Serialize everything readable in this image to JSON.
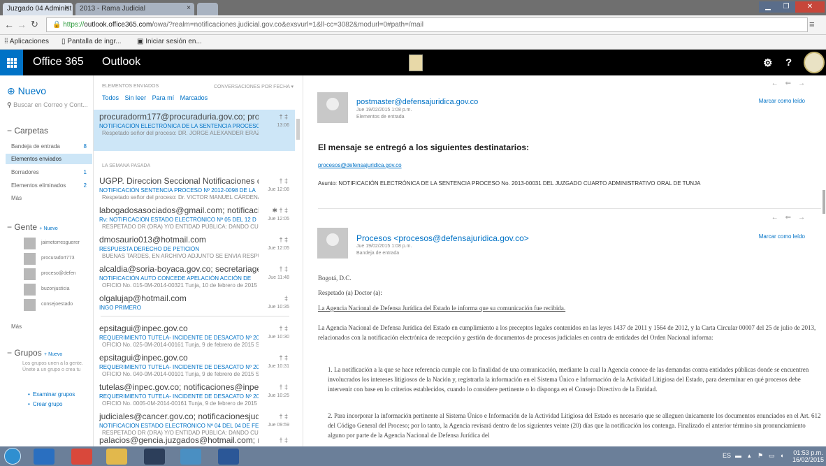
{
  "browser": {
    "tabs": [
      {
        "label": "Juzgado 04 Administ"
      },
      {
        "label": "2013 - Rama Judicial"
      }
    ],
    "url_scheme": "https://",
    "url_host": "outlook.office365.com",
    "url_rest": "/owa/?realm=notificaciones.judicial.gov.co&exsvurl=1&ll-cc=3082&modurl=0#path=/mail",
    "bookmarks": [
      "Aplicaciones",
      "Pantalla de ingr...",
      "Iniciar sesión en..."
    ]
  },
  "header": {
    "brand": "Office 365",
    "app": "Outlook",
    "settings_icon": "gear-icon",
    "help_label": "?"
  },
  "leftnav": {
    "new_label": "Nuevo",
    "search_placeholder": "Buscar en Correo y Cont...",
    "folders_label": "Carpetas",
    "folders": [
      {
        "label": "Bandeja de entrada",
        "count": "8"
      },
      {
        "label": "Elementos enviados",
        "count": ""
      },
      {
        "label": "Borradores",
        "count": "1"
      },
      {
        "label": "Elementos eliminados",
        "count": "2"
      },
      {
        "label": "Más",
        "count": ""
      }
    ],
    "people_label": "Gente",
    "people_new": "+ Nuevo",
    "contacts": [
      "jaimetorresguerer",
      "procuradort773",
      "proceso@defen",
      "buzonjusticia",
      "consejoestado"
    ],
    "people_more": "Más",
    "groups_label": "Grupos",
    "groups_new": "+ Nuevo",
    "groups_desc": "Los grupos unen a la gente. Únete a un grupo o crea tu",
    "groups_links": [
      "Examinar grupos",
      "Crear grupo"
    ]
  },
  "msglist": {
    "top_left": "ELEMENTOS ENVIADOS",
    "top_right": "CONVERSACIONES POR FECHA ▾",
    "filters": [
      "Todos",
      "Sin leer",
      "Para mí",
      "Marcados"
    ],
    "section_label": "LA SEMANA PASADA",
    "messages": [
      {
        "from": "procuradorm177@procuraduria.gov.co; proc",
        "subj": "NOTIFICACIÓN ELECTRÓNICA DE LA SENTENCIA PROCESO",
        "prev": "Respetado señor del proceso: DR. JORGE ALEXANDER ERAZO ERAZO...",
        "time": "13:06",
        "flags": "† ‡"
      },
      {
        "from": "UGPP. Direccion Seccional Notificaciones de",
        "subj": "NOTIFICACIÓN SENTENCIA PROCESO Nº 2012-0098 DE LA",
        "prev": "Respetado señor del proceso: Dr. VICTOR MANUEL CÁRDENAS...",
        "time": "Jue 12:08",
        "flags": "† ‡"
      },
      {
        "from": "labogadosasociados@gmail.com; notificaci",
        "subj": "Rv: NOTIFICACIÓN ESTADO ELECTRÓNICO Nº 05 DEL 12 D",
        "prev": "RESPETADO DR (DRA) Y/O ENTIDAD PÚBLICA: DANDO CUMPLI...",
        "time": "Jue 12:05",
        "flags": "✱ † ‡"
      },
      {
        "from": "dmosaurio013@hotmail.com",
        "subj": "RESPUESTA DERECHO DE PETICIÓN",
        "prev": "BUENAS TARDES,  EN ARCHIVO ADJUNTO SE ENVIA RESPUESTA...",
        "time": "Jue 12:05",
        "flags": "† ‡"
      },
      {
        "from": "alcaldia@soria-boyaca.gov.co; secretariagen",
        "subj": "NOTIFICACIÓN AUTO CONCEDE APELACIÓN ACCIÓN DE",
        "prev": "OFICIO No. 015-0M-2014-00321  Tunja, 10 de febrero de 2015  S...",
        "time": "Jue 11:48",
        "flags": "† ‡"
      },
      {
        "from": "olgalujap@hotmail.com",
        "subj": "INGO PRIMERO",
        "prev": "",
        "time": "Jue 10:35",
        "flags": "‡"
      },
      {
        "from": "epsitagui@inpec.gov.co",
        "subj": "REQUERIMIENTO TUTELA- INCIDENTE DE DESACATO Nº 20",
        "prev": "OFICIO No. 025-0M-2014-00161  Tunja, 9 de febrero de 2015  S...",
        "time": "Jue 10:30",
        "flags": "† ‡"
      },
      {
        "from": "epsitagui@inpec.gov.co",
        "subj": "REQUERIMIENTO TUTELA- INCIDENTE DE DESACATO Nº 20",
        "prev": "OFICIO No. 040-0M-2014-00101  Tunja, 9 de febrero de 2015  S...",
        "time": "Jue 10:31",
        "flags": "† ‡"
      },
      {
        "from": "tutelas@inpec.gov.co; notificaciones@inpec",
        "subj": "REQUERIMIENTO TUTELA- INCIDENTE DE DESACATO Nº 20",
        "prev": "OFICIO No. 0005-0M-2014-00161  Tunja, 9 de febrero de 2015  Se...",
        "time": "Jue 10:25",
        "flags": "† ‡"
      },
      {
        "from": "judiciales@cancer.gov.co; notificacionesjudici",
        "subj": "NOTIFICACIÓN ESTADO ELECTRÓNICO Nº 04 DEL 04 DE FE",
        "prev": "RESPETADO DR (DRA) Y/O ENTIDAD PÚBLICA: DANDO CUMPLI...",
        "time": "Jue 09:59",
        "flags": "† ‡"
      },
      {
        "from": "palacios@gencia.juzgados@hotmail.com; no",
        "subj": "",
        "prev": "",
        "time": "",
        "flags": "† ‡"
      }
    ]
  },
  "reading": {
    "first": {
      "sender": "postmaster@defensajuridica.gov.co",
      "date": "Jue 19/02/2015 1:08 p.m.",
      "to": "Elementos de entrada",
      "mark_label": "Marcar como leído",
      "title": "El mensaje se entregó a los siguientes destinatarios:",
      "recipient": "procesos@defensajuridica.gov.co",
      "subject_line": "Asunto: NOTIFICACIÓN ELECTRÓNICA DE LA SENTENCIA PROCESO No. 2013-00031 DEL JUZGADO CUARTO ADMINISTRATIVO ORAL DE TUNJA"
    },
    "second": {
      "sender": "Procesos <procesos@defensajuridica.gov.co>",
      "date": "Jue 19/02/2015 1:08 p.m.",
      "to": "Bandeja de entrada",
      "mark_label": "Marcar como leído",
      "greeting_city": "Bogotá, D.C.",
      "greeting": "Respetado (a) Doctor (a):",
      "heading": "La Agencia Nacional de Defensa Jurídica del Estado le informa que su comunicación fue recibida.",
      "p1": "La Agencia Nacional de Defensa Jurídica del Estado en cumplimiento a los preceptos legales contenidos en las leyes 1437 de 2011 y 1564 de 2012, y la Carta Circular 00007 del 25 de julio de 2013, relacionados con la notificación electrónica de recepción y gestión de documentos de procesos judiciales en contra de entidades del Orden Nacional informa:",
      "p2": "1.          La notificación a la que se hace referencia cumple con la finalidad de una comunicación, mediante la cual la Agencia conoce de las demandas contra entidades públicas donde se encuentren involucrados los intereses litigiosos de la Nación y, registrarla la información en el Sistema Único e Información de la Actividad Litigiosa del Estado, para determinar en qué procesos debe intervenir con base en lo criterios establecidos, cuando lo considere pertinente o lo disponga en el Consejo Directivo de la Entidad.",
      "p3": "2.          Para incorporar la información pertinente al Sistema Único e Información de la Actividad Litigiosa del Estado es necesario que se alleguen únicamente los documentos enunciados en el Art. 612 del Código General del Proceso; por lo tanto, la Agencia revisará dentro de los siguientes veinte (20) días que la notificación los contenga. Finalizado el anterior término sin pronunciamiento alguno por parte de la Agencia Nacional de Defensa Jurídica del"
    }
  },
  "taskbar": {
    "lang": "ES",
    "time": "01:53 p.m.",
    "date": "16/02/2015"
  }
}
